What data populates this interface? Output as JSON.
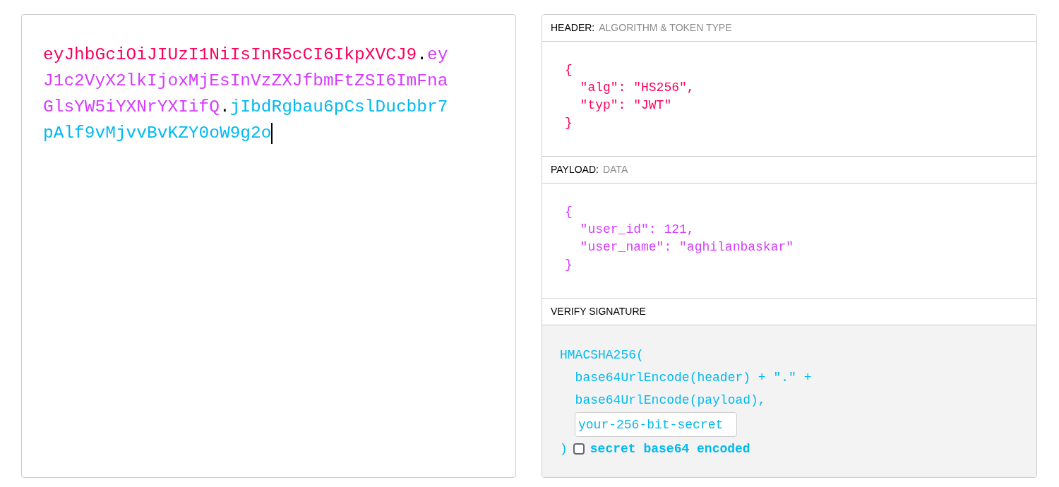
{
  "encoded_token": {
    "segments": [
      {
        "text": "eyJhbGciOiJIUzI1NiIsInR5cCI6IkpXVCJ9",
        "color": "#fb015b"
      },
      {
        "text": ".",
        "color": "#000000"
      },
      {
        "text": "eyJ1c2VyX2lkIjoxMjEsInVzZXJfbmFtZSI6ImFnaGlsYW5iYXNrYXIifQ",
        "color": "#d63aff"
      },
      {
        "text": ".",
        "color": "#000000"
      },
      {
        "text": "jIbdRgbau6pCslDucbbr7pAlf9vMjvvBvKZY0oW9g2o",
        "color": "#00b9f1"
      }
    ],
    "caret": true
  },
  "decoded": {
    "header": {
      "title": "HEADER:",
      "subtitle": "ALGORITHM & TOKEN TYPE",
      "color": "#fb015b",
      "lines": [
        "{",
        "  \"alg\": \"HS256\",",
        "  \"typ\": \"JWT\"",
        "}"
      ]
    },
    "payload": {
      "title": "PAYLOAD:",
      "subtitle": "DATA",
      "color": "#d63aff",
      "lines": [
        "{",
        "  \"user_id\": 121,",
        "  \"user_name\": \"aghilanbaskar\"",
        "}"
      ]
    },
    "verify_signature": {
      "title": "VERIFY SIGNATURE",
      "lines": [
        "HMACSHA256(",
        "  base64UrlEncode(header) + \".\" +",
        "  base64UrlEncode(payload),"
      ],
      "secret": {
        "value": "your-256-bit-secret"
      },
      "closing": ")",
      "base64_checkbox": {
        "label": "secret base64 encoded",
        "checked": false
      }
    }
  }
}
